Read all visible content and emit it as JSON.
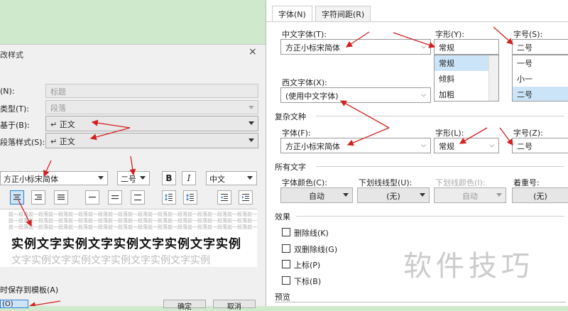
{
  "left_dialog": {
    "title": "改样式",
    "close": "×",
    "name_label": "(N):",
    "name_value": "标题",
    "type_label": "类型(T):",
    "type_value": "段落",
    "based_label": "基于(B):",
    "based_value": "↵ 正文",
    "next_label": "段落样式(S):",
    "next_value": "↵ 正文",
    "font_value": "方正小标宋简体",
    "size_value": "二号",
    "bold": "B",
    "italic": "I",
    "lang_value": "中文",
    "preview_small": "前一段落前一段落前一段落前一段落前一段落前一段落前一段落前一段落前一段落前一段落前一段落前一段落前一段落前一段落前一段落前一段落",
    "preview_big": "实例文字实例文字实例文字实例文字实例",
    "preview_next": "文字实例文字实例文字实例文字实例文字实例",
    "save_template": "时保存到模板(A)",
    "ok": "确定",
    "cancel": "取消",
    "bottom_label": "(O)"
  },
  "right_dialog": {
    "tabs": [
      "字体(N)",
      "字符间距(R)"
    ],
    "cn_font_label": "中文字体(T):",
    "cn_font_value": "方正小标宋简体",
    "style_label": "字形(Y):",
    "style_value": "常规",
    "style_options": [
      "常规",
      "倾斜",
      "加粗"
    ],
    "size_label": "字号(S):",
    "size_value": "二号",
    "size_options": [
      "一号",
      "小一",
      "二号"
    ],
    "west_font_label": "西文字体(X):",
    "west_font_value": "(使用中文字体)",
    "complex_section": "复杂文种",
    "complex_font_label": "字体(F):",
    "complex_font_value": "方正小标宋简体",
    "complex_style_label": "字形(L):",
    "complex_style_value": "常规",
    "complex_size_label": "字号(Z):",
    "complex_size_value": "二号",
    "all_text_section": "所有文字",
    "font_color_label": "字体颜色(C):",
    "font_color_value": "自动",
    "underline_label": "下划线线型(U):",
    "underline_value": "(无)",
    "underline_color_label": "下划线颜色(I):",
    "underline_color_value": "自动",
    "emphasis_label": "着重号:",
    "emphasis_value": "(无)",
    "effects_section": "效果",
    "strike": "删除线(K)",
    "double_strike": "双删除线(G)",
    "superscript": "上标(P)",
    "subscript": "下标(B)",
    "preview_section": "预览"
  },
  "watermark": "软件技巧",
  "colors": {
    "arrow": "#d42020",
    "accent": "#2a7fd4",
    "highlight": "#cce4f7"
  }
}
